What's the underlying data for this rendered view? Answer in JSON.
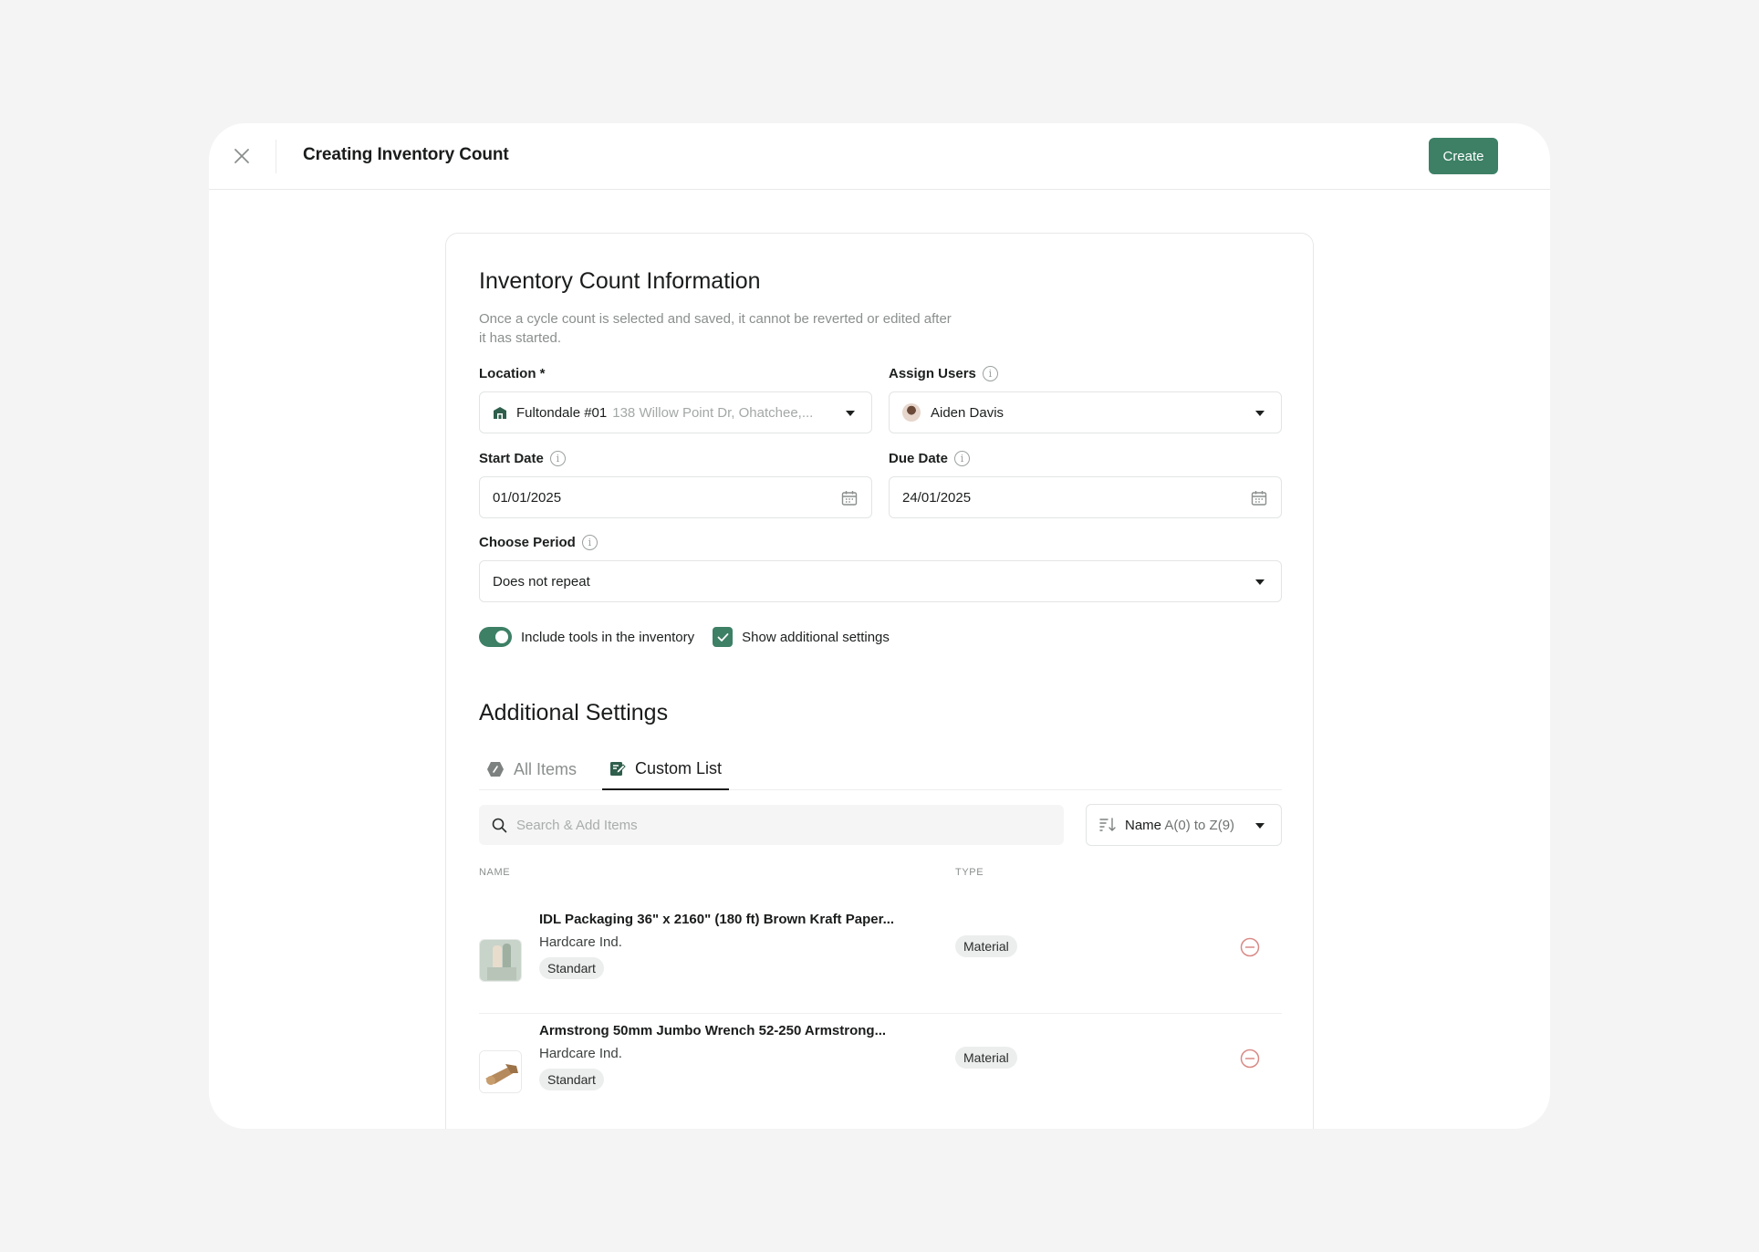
{
  "header": {
    "title": "Creating Inventory Count",
    "create_label": "Create"
  },
  "info_section": {
    "title": "Inventory Count Information",
    "description": "Once a cycle count is selected and saved, it cannot be reverted or edited after it has started."
  },
  "fields": {
    "location": {
      "label": "Location *",
      "name": "Fultondale #01",
      "address": "138 Willow Point Dr, Ohatchee,..."
    },
    "assign_users": {
      "label": "Assign Users",
      "value": "Aiden Davis"
    },
    "start_date": {
      "label": "Start Date",
      "value": "01/01/2025"
    },
    "due_date": {
      "label": "Due Date",
      "value": "24/01/2025"
    },
    "period": {
      "label": "Choose Period",
      "value": "Does not repeat"
    }
  },
  "options": {
    "include_tools_label": "Include tools in the inventory",
    "include_tools_on": true,
    "show_additional_label": "Show additional settings",
    "show_additional_checked": true
  },
  "additional": {
    "title": "Additional Settings",
    "tabs": [
      {
        "label": "All Items",
        "active": false,
        "icon": "hexagon-tag-icon"
      },
      {
        "label": "Custom List",
        "active": true,
        "icon": "edit-list-icon"
      }
    ],
    "search_placeholder": "Search & Add Items",
    "sort_field": "Name",
    "sort_order": "A(0) to Z(9)",
    "columns": {
      "name": "NAME",
      "type": "TYPE"
    },
    "items": [
      {
        "name": "IDL Packaging 36\" x 2160\" (180 ft) Brown Kraft Paper...",
        "vendor": "Hardcare Ind.",
        "tag": "Standart",
        "type": "Material"
      },
      {
        "name": "Armstrong 50mm Jumbo Wrench 52-250 Armstrong...",
        "vendor": "Hardcare Ind.",
        "tag": "Standart",
        "type": "Material"
      }
    ]
  },
  "colors": {
    "accent": "#3d8066",
    "remove": "#d98a86"
  }
}
